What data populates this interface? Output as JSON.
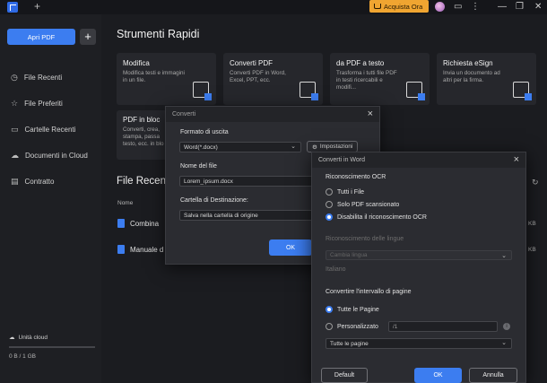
{
  "titlebar": {
    "buy_label": "Acquista Ora",
    "tab_add": "+"
  },
  "sidebar": {
    "open_pdf": "Apri PDF",
    "add": "+",
    "items": [
      {
        "label": "File Recenti",
        "icon": "clock-icon"
      },
      {
        "label": "File Preferiti",
        "icon": "star-icon"
      },
      {
        "label": "Cartelle Recenti",
        "icon": "folder-icon"
      },
      {
        "label": "Documenti in Cloud",
        "icon": "cloud-icon"
      },
      {
        "label": "Contratto",
        "icon": "contract-icon"
      }
    ],
    "cloud_label": "Unità cloud",
    "cloud_size": "0 B / 1 GB"
  },
  "main": {
    "title": "Strumenti Rapidi",
    "cards": [
      {
        "title": "Modifica",
        "desc": "Modifica testi e immagini in un file."
      },
      {
        "title": "Converti PDF",
        "desc": "Converti PDF in Word, Excel, PPT, ecc."
      },
      {
        "title": "da PDF a testo",
        "desc": "Trasforma i tutti file PDF in testi ricercabili e modifi..."
      },
      {
        "title": "Richiesta eSign",
        "desc": "Invia un documento ad altri per la firma."
      }
    ],
    "card5": {
      "title": "PDF in bloc",
      "lines": [
        "Converti, crea,",
        "stampa, passa",
        "testo, ecc. in blo"
      ]
    },
    "files_title": "File Recen",
    "col_name": "Nome",
    "files": [
      {
        "name": "Combina",
        "size": "KB"
      },
      {
        "name": "Manuale d",
        "size": "KB"
      }
    ]
  },
  "dialog_convert": {
    "title": "Converti",
    "format_label": "Formato di uscita",
    "format_value": "Word(*.docx)",
    "settings_label": "Impostazioni",
    "filename_label": "Nome del file",
    "filename_value": "Lorem_ipsum.docx",
    "dest_label": "Cartella di Destinazione:",
    "dest_value": "Salva nella cartella di origine",
    "ok": "OK"
  },
  "dialog_word": {
    "title": "Converti in Word",
    "ocr_heading": "Riconoscimento OCR",
    "ocr_options": [
      "Tutti i File",
      "Solo PDF scansionato",
      "Disabilita il riconoscimento OCR"
    ],
    "ocr_selected": 2,
    "lang_heading": "Riconoscimento delle lingue",
    "lang_select": "Cambia lingua",
    "lang_value": "Italiano",
    "range_heading": "Convertire l'intervallo di pagine",
    "range_options": [
      "Tutte le Pagine",
      "Personalizzato"
    ],
    "range_selected": 0,
    "custom_value": "/1",
    "pages_select": "Tutte le pagine",
    "default_btn": "Default",
    "ok_btn": "OK",
    "cancel_btn": "Annulla"
  }
}
